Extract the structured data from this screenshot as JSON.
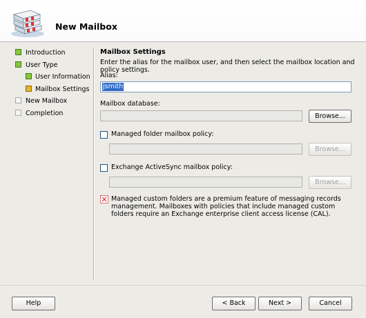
{
  "header": {
    "title": "New Mailbox",
    "icon": "mailbox-stack-icon"
  },
  "nav": {
    "items": [
      {
        "label": "Introduction",
        "status": "done",
        "level": 0
      },
      {
        "label": "User Type",
        "status": "done",
        "level": 0
      },
      {
        "label": "User Information",
        "status": "done",
        "level": 1
      },
      {
        "label": "Mailbox Settings",
        "status": "current",
        "level": 1
      },
      {
        "label": "New Mailbox",
        "status": "pending",
        "level": 0
      },
      {
        "label": "Completion",
        "status": "pending",
        "level": 0
      }
    ]
  },
  "main": {
    "section_title": "Mailbox Settings",
    "description": "Enter the alias for the mailbox user, and then select the mailbox location and policy settings.",
    "alias_label": "Alias:",
    "alias_value": "jsmith",
    "database_label": "Mailbox database:",
    "database_value": "",
    "browse_label": "Browse...",
    "managed_folder_label": "Managed folder mailbox policy:",
    "managed_folder_checked": false,
    "activesync_label": "Exchange ActiveSync mailbox policy:",
    "activesync_checked": false,
    "info_text": "Managed custom folders are a premium feature of messaging records management. Mailboxes with policies that include managed custom folders require an Exchange enterprise client access license (CAL)."
  },
  "footer": {
    "help": "Help",
    "back": "< Back",
    "next": "Next >",
    "cancel": "Cancel"
  },
  "colors": {
    "done": "#8bc43f",
    "current": "#e3b32d",
    "pending": "#f4f4f4",
    "background": "#ecebe6"
  }
}
